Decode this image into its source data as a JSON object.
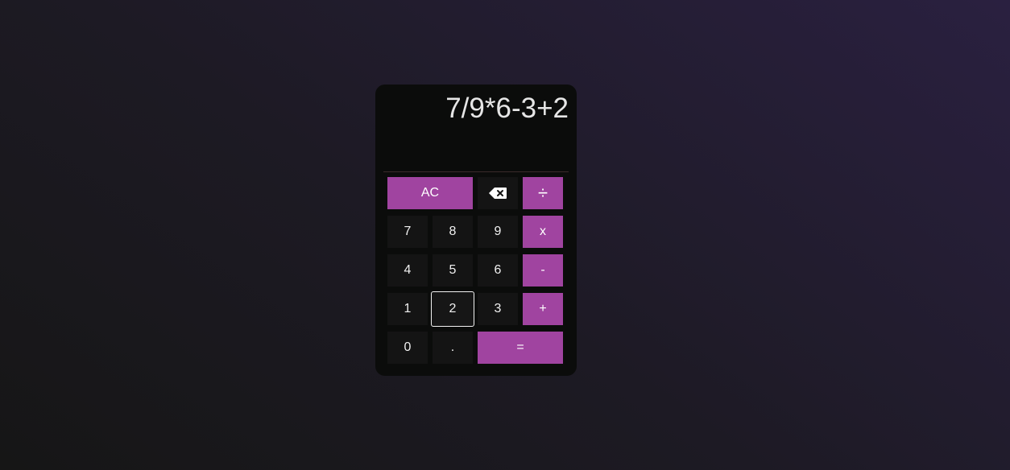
{
  "display": {
    "expression": "7/9*6-3+2"
  },
  "keys": {
    "clear": "AC",
    "divide": "÷",
    "multiply": "x",
    "subtract": "-",
    "add": "+",
    "equals": "=",
    "decimal": ".",
    "d0": "0",
    "d1": "1",
    "d2": "2",
    "d3": "3",
    "d4": "4",
    "d5": "5",
    "d6": "6",
    "d7": "7",
    "d8": "8",
    "d9": "9",
    "backspace_icon": "backspace-icon"
  },
  "colors": {
    "accent": "#a044a0",
    "key_bg": "#141414",
    "panel_bg": "#0b0c0b"
  }
}
